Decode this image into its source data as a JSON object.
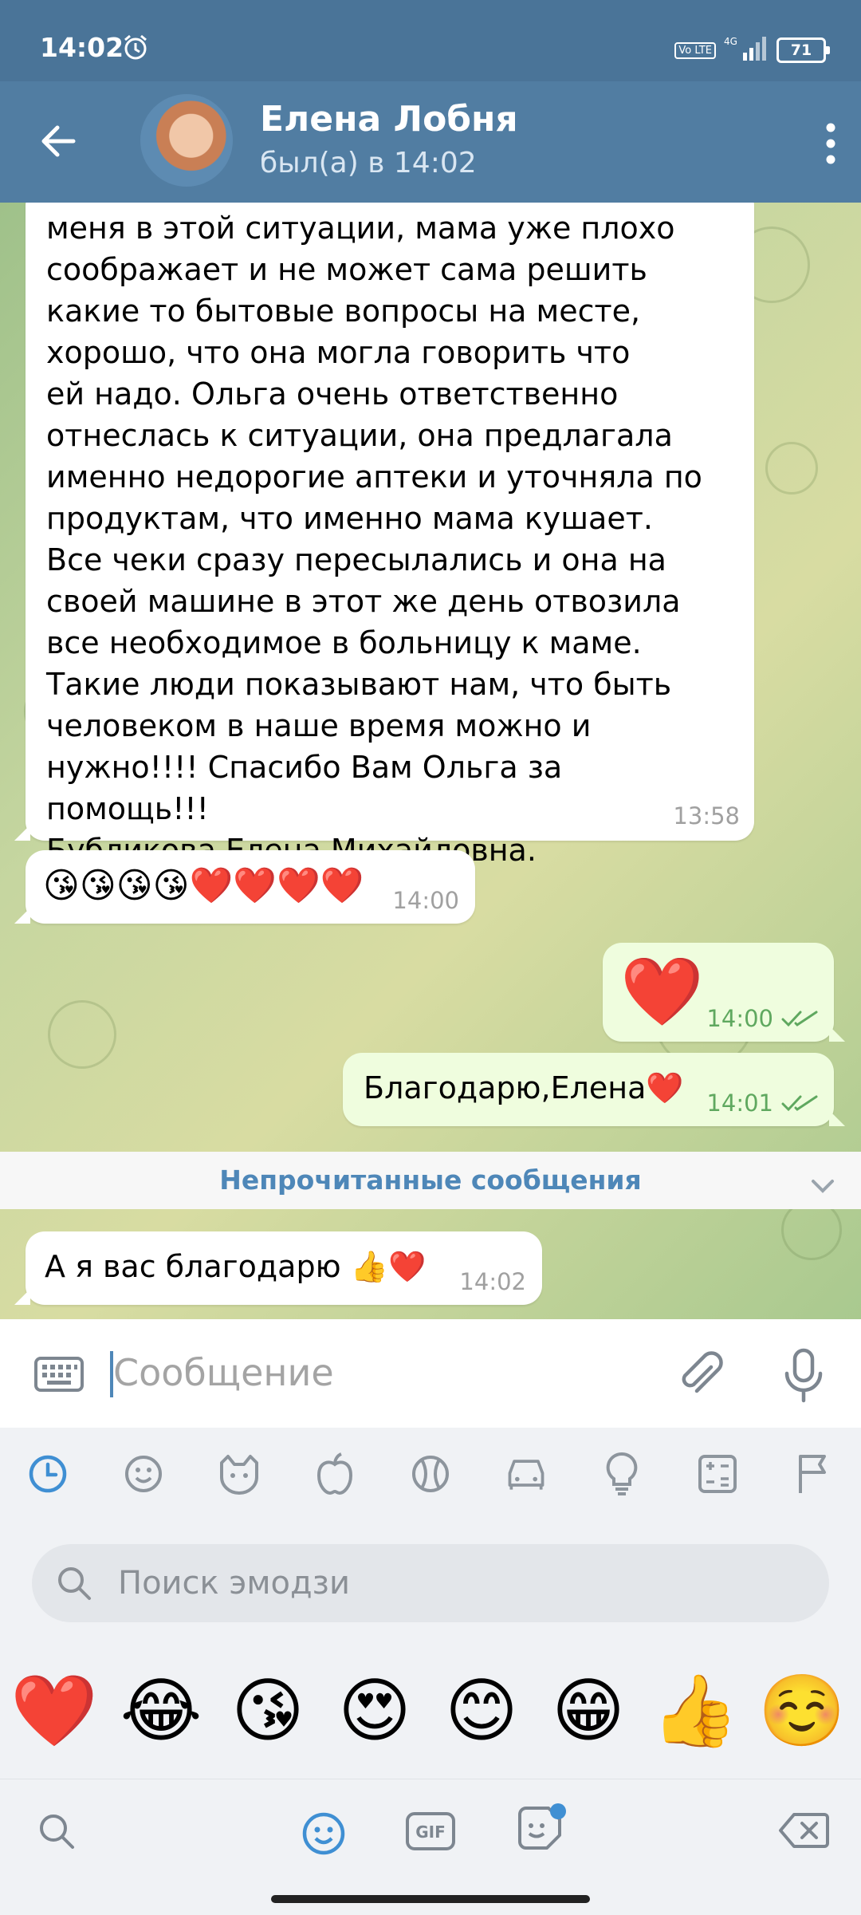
{
  "status": {
    "time": "14:02",
    "volte": "Vo LTE",
    "network": "4G",
    "battery": "71"
  },
  "header": {
    "name": "Елена Лобня",
    "subtitle": "был(а) в 14:02"
  },
  "messages": [
    {
      "id": "m1",
      "direction": "in",
      "text": "меня в этой ситуации, мама уже плохо\nсоображает и не может сама решить\nкакие то бытовые вопросы на месте,\nхорошо, что она могла говорить что\nей надо. Ольга очень ответственно\nотнеслась к ситуации, она предлагала\nименно недорогие аптеки и уточняла по\nпродуктам, что именно мама кушает.\nВсе чеки сразу пересылались и она на\nсвоей машине в этот же день отвозила\nвсе необходимое в больницу к маме.\nТакие люди показывают нам, что быть\nчеловеком в наше время можно и\nнужно!!!! Спасибо Вам Ольга за помощь!!!\nБубликова Елена Михайловна.",
      "time": "13:58"
    },
    {
      "id": "m2",
      "direction": "in",
      "text": "😘😘😘😘❤️❤️❤️❤️",
      "time": "14:00"
    },
    {
      "id": "m3",
      "direction": "out",
      "text": "❤️",
      "time": "14:00"
    },
    {
      "id": "m4",
      "direction": "out",
      "text": "Благодарю,Елена❤️",
      "time": "14:01"
    },
    {
      "id": "m5",
      "direction": "in",
      "text": "А я вас благодарю 👍❤️",
      "time": "14:02"
    }
  ],
  "unread_label": "Непрочитанные сообщения",
  "input": {
    "placeholder": "Сообщение"
  },
  "emoji_panel": {
    "categories": [
      "recent-icon",
      "smile-icon",
      "animal-icon",
      "food-icon",
      "sport-icon",
      "travel-icon",
      "objects-icon",
      "symbols-icon",
      "flags-icon"
    ],
    "search_placeholder": "Поиск эмодзи",
    "emojis": [
      "❤️",
      "😂",
      "😘",
      "😍",
      "😊",
      "😁",
      "👍",
      "☺️"
    ],
    "bottom_tabs": [
      "search-icon",
      "emoji-icon",
      "gif-icon",
      "sticker-icon",
      "backspace-icon"
    ]
  }
}
